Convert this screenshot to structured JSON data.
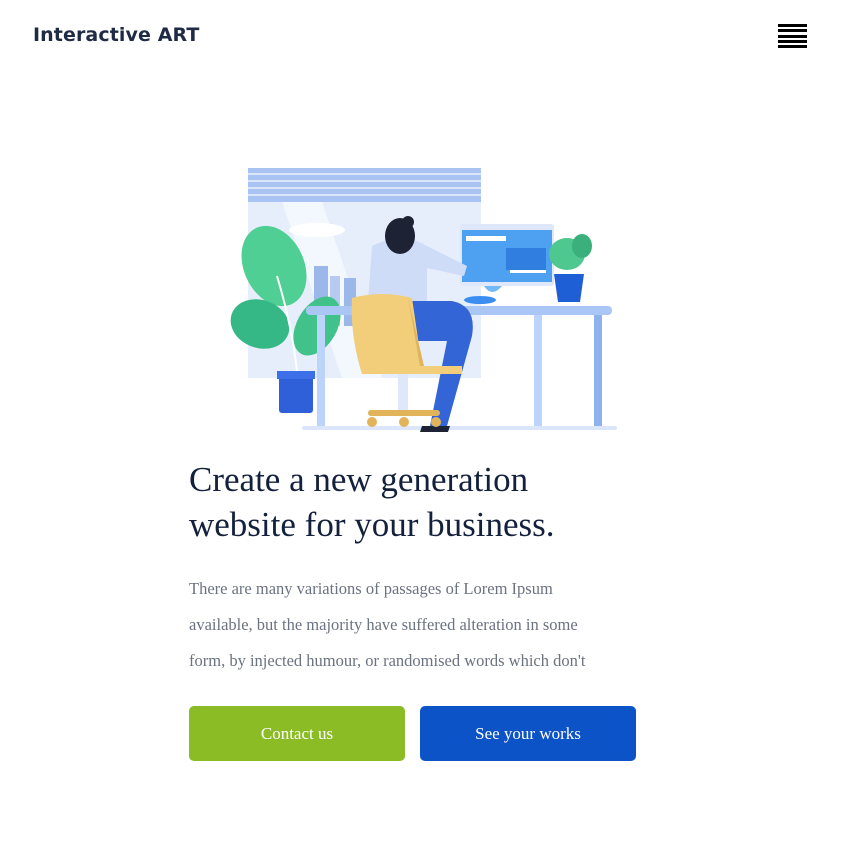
{
  "header": {
    "brand": "Interactive ART",
    "menu_icon": "hamburger-menu-icon"
  },
  "hero": {
    "illustration": "person-working-at-desk-illustration",
    "headline_line1": "Create a new generation",
    "headline_line2": "website for your business.",
    "body_line1": "There are many variations of passages of Lorem Ipsum",
    "body_line2": "available, but the majority have suffered alteration in some",
    "body_line3": "form, by injected humour, or randomised words which don't",
    "contact_label": "Contact us",
    "works_label": "See your works"
  },
  "colors": {
    "contact_bg": "#8bbc26",
    "works_bg": "#0c53c8",
    "text_dark": "#14213d",
    "text_muted": "#6b7280"
  }
}
